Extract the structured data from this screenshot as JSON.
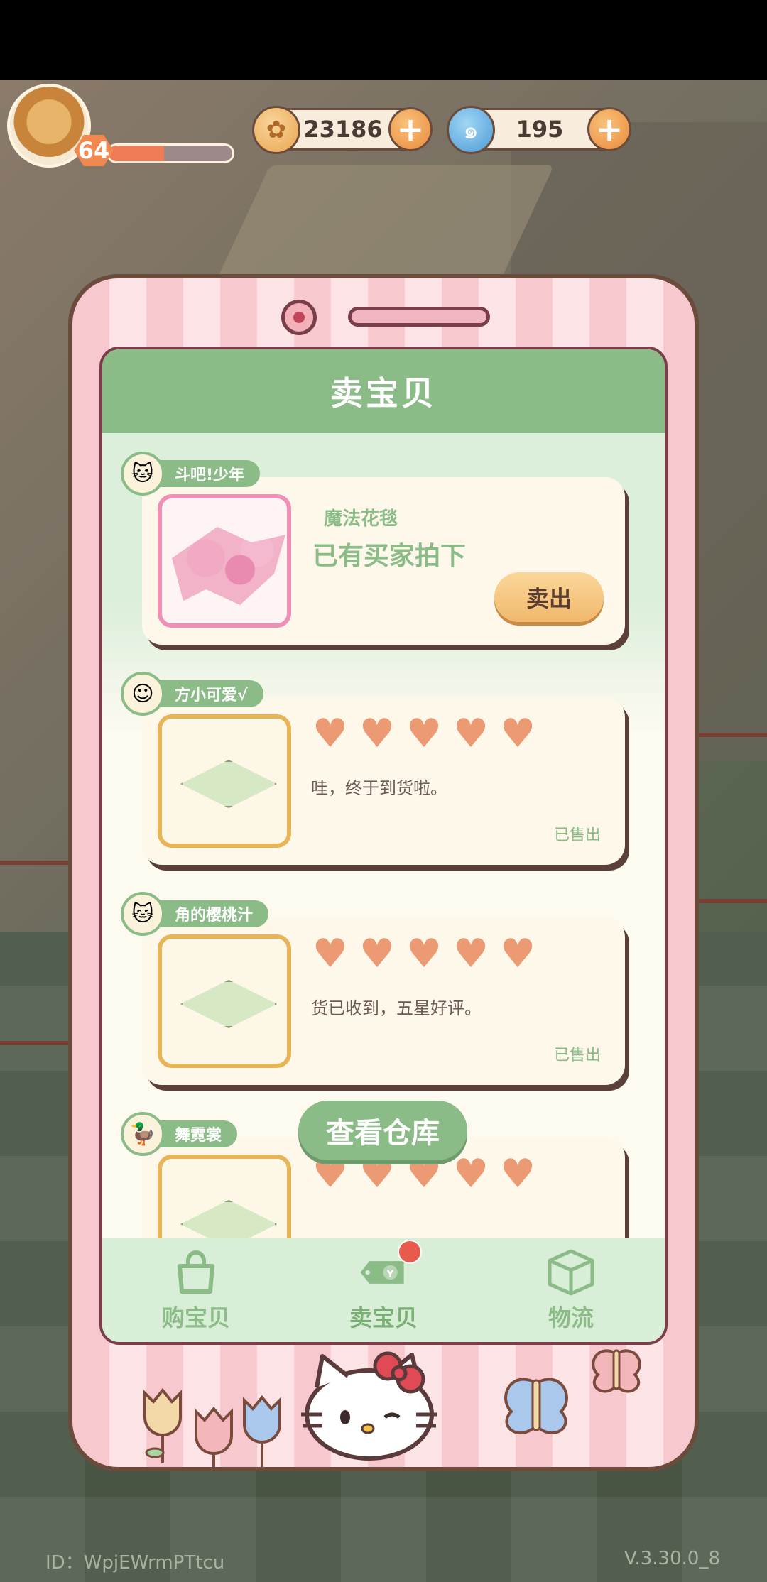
{
  "hud": {
    "level": "64",
    "xp_fraction": 0.45,
    "coins": "23186",
    "gems": "195"
  },
  "screen": {
    "title": "卖宝贝",
    "items": [
      {
        "user": "斗吧!少年",
        "title": "魔法花毯",
        "status": "已有买家拍下",
        "sell_label": "卖出"
      },
      {
        "user": "方小可爱√",
        "hearts": 5,
        "comment": "哇，终于到货啦。",
        "sold": "已售出"
      },
      {
        "user": "角的樱桃汁",
        "hearts": 5,
        "comment": "货已收到，五星好评。",
        "sold": "已售出"
      },
      {
        "user": "舞霓裳",
        "hearts": 5
      }
    ],
    "warehouse_button": "查看仓库",
    "tabs": [
      {
        "label": "购宝贝",
        "icon": "shopping-bag-icon"
      },
      {
        "label": "卖宝贝",
        "icon": "price-tag-icon"
      },
      {
        "label": "物流",
        "icon": "package-box-icon"
      }
    ]
  },
  "footer": {
    "id": "ID：WpjEWrmPTtcu",
    "version": "V.3.30.0_8"
  },
  "colors": {
    "accent_green": "#8bbc88",
    "heart": "#ec9a74",
    "phone_pink": "#f7c9cf",
    "outline": "#6b4b3c"
  }
}
